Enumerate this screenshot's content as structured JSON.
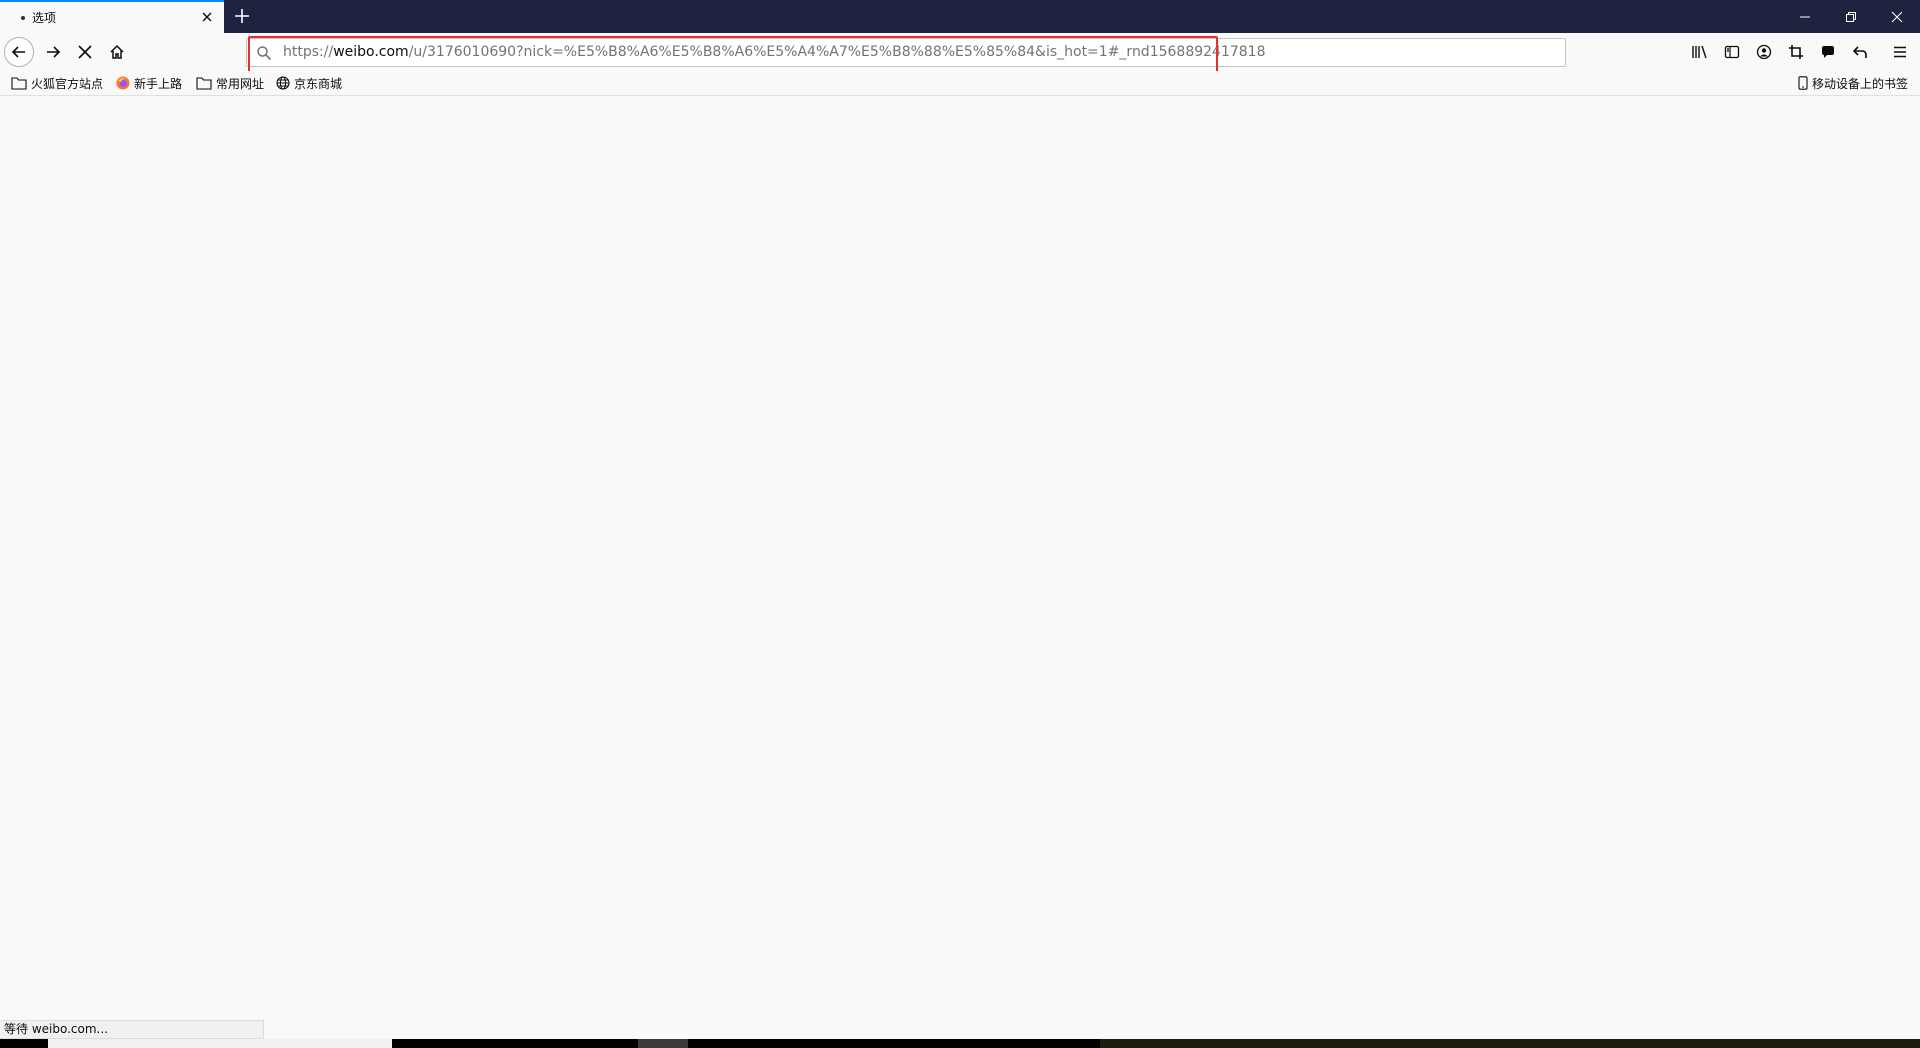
{
  "tab": {
    "title": "选项"
  },
  "address_bar": {
    "url_prefix": "https://",
    "url_host": "weibo.com",
    "url_path": "/u/3176010690?nick=%E5%B8%A6%E5%B8%A6%E5%A4%A7%E5%B8%88%E5%85%84&is_hot=1#_rnd1568892417818"
  },
  "bookmarks": [
    {
      "label": "火狐官方站点",
      "icon": "folder-icon"
    },
    {
      "label": "新手上路",
      "icon": "firefox-icon"
    },
    {
      "label": "常用网址",
      "icon": "folder-icon"
    },
    {
      "label": "京东商城",
      "icon": "globe-icon"
    }
  ],
  "mobile_bookmarks": {
    "label": "移动设备上的书签"
  },
  "status": {
    "text": "等待 weibo.com..."
  },
  "colors": {
    "tab_accent": "#0a84ff",
    "titlebar": "#202340",
    "highlight": "#e0302f"
  }
}
